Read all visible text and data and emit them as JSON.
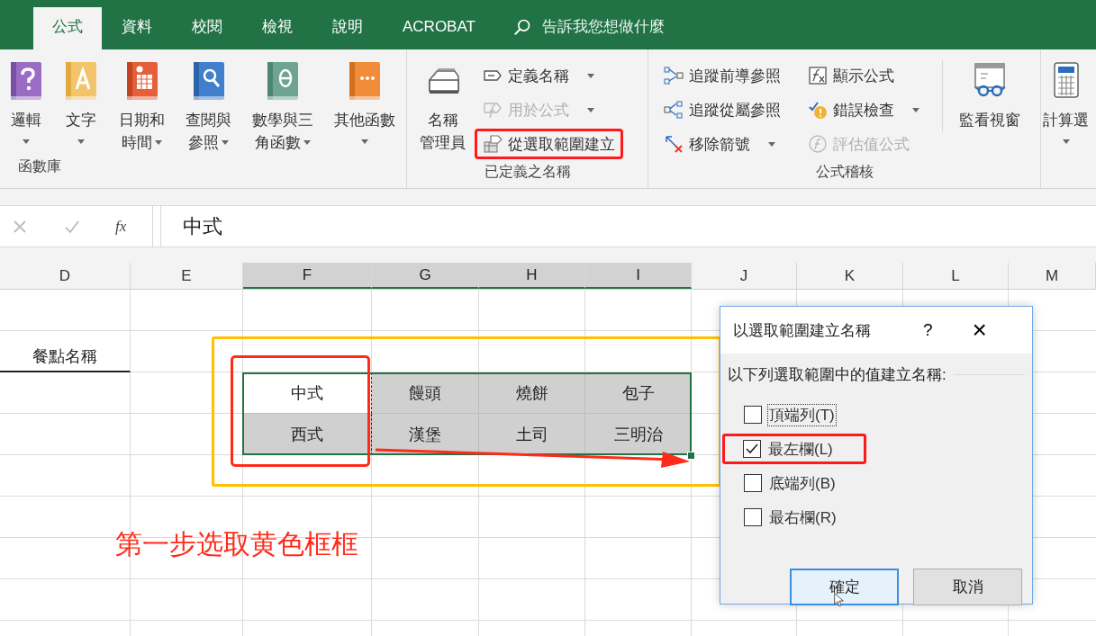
{
  "ribbon_tabs": [
    {
      "label": "公式",
      "selected": true
    },
    {
      "label": "資料",
      "selected": false
    },
    {
      "label": "校閱",
      "selected": false
    },
    {
      "label": "檢視",
      "selected": false
    },
    {
      "label": "說明",
      "selected": false
    },
    {
      "label": "ACROBAT",
      "selected": false
    }
  ],
  "tell_me": "告訴我您想做什麼",
  "ribbon_groups": [
    {
      "label": "函數庫",
      "items": [
        {
          "kind": "large",
          "lines": [
            "邏輯"
          ],
          "dropdown": true
        },
        {
          "kind": "large",
          "lines": [
            "文字"
          ],
          "dropdown": true
        },
        {
          "kind": "large",
          "lines": [
            "日期和",
            "時間"
          ],
          "dropdown": true
        },
        {
          "kind": "large",
          "lines": [
            "查閱與",
            "參照"
          ],
          "dropdown": true
        },
        {
          "kind": "large",
          "lines": [
            "數學與三",
            "角函數"
          ],
          "dropdown": true
        },
        {
          "kind": "large",
          "lines": [
            "其他函數"
          ],
          "dropdown": true
        }
      ]
    },
    {
      "label": "已定義之名稱",
      "items": [
        {
          "kind": "large",
          "lines": [
            "名稱",
            "管理員"
          ],
          "dropdown": false
        },
        {
          "kind": "column",
          "items": [
            {
              "label": "定義名稱",
              "dropdown": true,
              "disabled": false,
              "highlighted": false
            },
            {
              "label": "用於公式",
              "dropdown": true,
              "disabled": true,
              "highlighted": false
            },
            {
              "label": "從選取範圍建立",
              "dropdown": false,
              "disabled": false,
              "highlighted": true
            }
          ]
        }
      ]
    },
    {
      "label": "公式稽核",
      "items": [
        {
          "kind": "column",
          "items": [
            {
              "label": "追蹤前導參照",
              "dropdown": false,
              "disabled": false,
              "highlighted": false
            },
            {
              "label": "追蹤從屬參照",
              "dropdown": false,
              "disabled": false,
              "highlighted": false
            },
            {
              "label": "移除箭號",
              "dropdown": true,
              "disabled": false,
              "highlighted": false
            }
          ]
        },
        {
          "kind": "column",
          "items": [
            {
              "label": "顯示公式",
              "dropdown": false,
              "disabled": false,
              "highlighted": false
            },
            {
              "label": "錯誤檢查",
              "dropdown": true,
              "disabled": false,
              "highlighted": false
            },
            {
              "label": "評估值公式",
              "dropdown": false,
              "disabled": true,
              "highlighted": false
            }
          ]
        },
        {
          "kind": "large",
          "lines": [
            "監看視窗"
          ],
          "dropdown": false
        }
      ]
    },
    {
      "items": [
        {
          "kind": "large",
          "lines": [
            "計算選"
          ],
          "dropdown": true
        }
      ]
    }
  ],
  "formula_bar": {
    "function_label": "fx",
    "value": "中式"
  },
  "sheet": {
    "columns": [
      {
        "label": "D",
        "selected": false
      },
      {
        "label": "E",
        "selected": false
      },
      {
        "label": "F",
        "selected": true
      },
      {
        "label": "G",
        "selected": true
      },
      {
        "label": "H",
        "selected": true
      },
      {
        "label": "I",
        "selected": true
      },
      {
        "label": "J",
        "selected": false
      },
      {
        "label": "K",
        "selected": false
      },
      {
        "label": "L",
        "selected": false
      },
      {
        "label": "M",
        "selected": false
      }
    ],
    "header_cell": "餐點名稱",
    "table": [
      [
        {
          "text": "中式",
          "active": true
        },
        {
          "text": "饅頭",
          "active": false
        },
        {
          "text": "燒餅",
          "active": false
        },
        {
          "text": "包子",
          "active": false
        }
      ],
      [
        {
          "text": "西式",
          "active": false
        },
        {
          "text": "漢堡",
          "active": false
        },
        {
          "text": "土司",
          "active": false
        },
        {
          "text": "三明治",
          "active": false
        }
      ]
    ]
  },
  "annotations": [
    {
      "kind": "frame",
      "color": "#ffc000"
    },
    {
      "kind": "frame",
      "color": "#ff2a1a"
    },
    {
      "kind": "arrow",
      "color": "#ff2a1a"
    },
    {
      "kind": "note",
      "text": "第一步选取黄色框框",
      "color": "#ff2a1a"
    }
  ],
  "dialog": {
    "title": "以選取範圍建立名稱",
    "help": "?",
    "close": "×",
    "prompt": "以下列選取範圍中的值建立名稱:",
    "options": [
      {
        "label": "頂端列(T)",
        "checked": false,
        "focused": true,
        "highlighted": false
      },
      {
        "label": "最左欄(L)",
        "checked": true,
        "focused": false,
        "highlighted": true
      },
      {
        "label": "底端列(B)",
        "checked": false,
        "focused": false,
        "highlighted": false
      },
      {
        "label": "最右欄(R)",
        "checked": false,
        "focused": false,
        "highlighted": false
      }
    ],
    "buttons": [
      {
        "label": "確定",
        "default": true
      },
      {
        "label": "取消",
        "default": false
      }
    ]
  }
}
